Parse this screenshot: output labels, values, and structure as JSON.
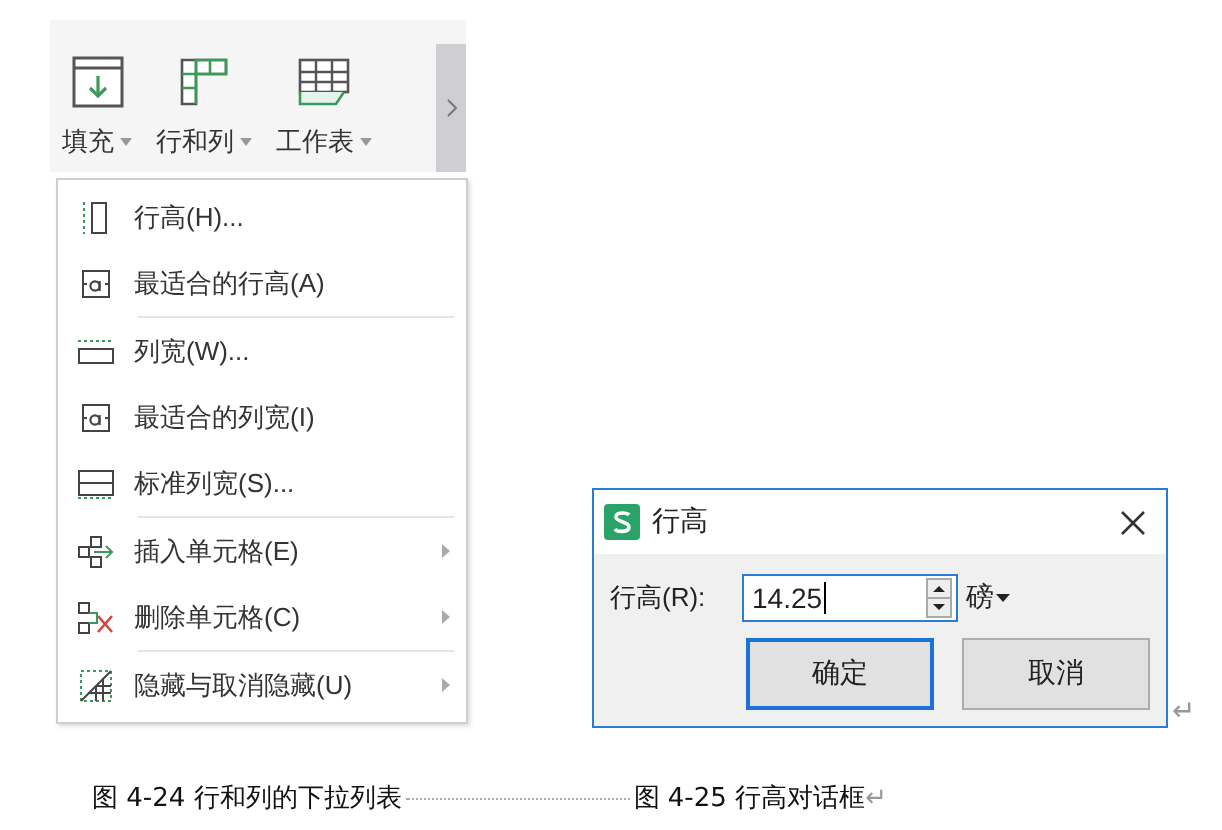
{
  "toolbar": {
    "buttons": [
      {
        "label": "填充",
        "kind": "fill"
      },
      {
        "label": "行和列",
        "kind": "rowcol"
      },
      {
        "label": "工作表",
        "kind": "sheet"
      }
    ]
  },
  "menu": {
    "groups": [
      [
        {
          "label": "行高(H)...",
          "kind": "row-height",
          "submenu": false
        },
        {
          "label": "最适合的行高(A)",
          "kind": "fit",
          "submenu": false
        }
      ],
      [
        {
          "label": "列宽(W)...",
          "kind": "col-width",
          "submenu": false
        },
        {
          "label": "最适合的列宽(I)",
          "kind": "fit",
          "submenu": false
        },
        {
          "label": "标准列宽(S)...",
          "kind": "std-width",
          "submenu": false
        }
      ],
      [
        {
          "label": "插入单元格(E)",
          "kind": "insert",
          "submenu": true
        },
        {
          "label": "删除单元格(C)",
          "kind": "delete",
          "submenu": true
        }
      ],
      [
        {
          "label": "隐藏与取消隐藏(U)",
          "kind": "hide",
          "submenu": true
        }
      ]
    ]
  },
  "dialog": {
    "title": "行高",
    "field_label": "行高(R):",
    "value": "14.25",
    "unit": "磅",
    "buttons": [
      {
        "label": "确定",
        "default": true
      },
      {
        "label": "取消",
        "default": false
      }
    ]
  },
  "captions": [
    {
      "text": "图 4-24 行和列的下拉列表"
    },
    {
      "text": "图 4-25 行高对话框"
    }
  ],
  "paragraph_mark": "↵"
}
